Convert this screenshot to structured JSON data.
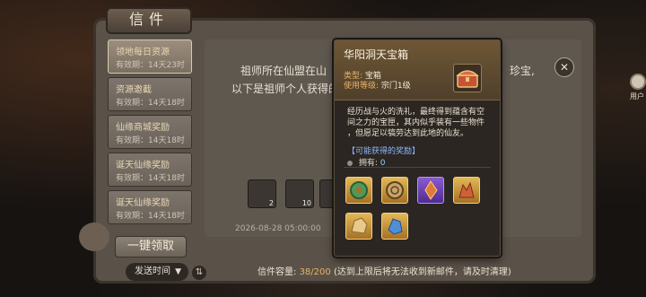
{
  "mail_panel": {
    "title": "信件",
    "mails": [
      {
        "title": "领地每日资源",
        "sub": "有效期：14天23时",
        "selected": true
      },
      {
        "title": "资源邀截",
        "sub": "有效期：14天18时",
        "selected": false
      },
      {
        "title": "仙缘商城奖励",
        "sub": "有效期：14天18时",
        "selected": false
      },
      {
        "title": "诞天仙缘奖励",
        "sub": "有效期：14天18时",
        "selected": false
      },
      {
        "title": "诞天仙缘奖励",
        "sub": "有效期：14天18时",
        "selected": false
      }
    ],
    "collect_all": "一键领取",
    "sort_label": "发送时间",
    "letter_line1": "祖师所在仙盟在山",
    "letter_line1_tail": "珍宝,",
    "letter_line2": "以下是祖师个人获得的ˋ",
    "attachments": [
      {
        "count": "2"
      },
      {
        "count": "10"
      },
      {
        "count": ""
      }
    ],
    "date": "2026-08-28 05:00:00",
    "capacity_label": "信件容量:",
    "capacity_value": "38/200",
    "capacity_note": "(达到上限后将无法收到新邮件，请及时清理)"
  },
  "side": {
    "user_label": "用户"
  },
  "tooltip": {
    "title": "华阳洞天宝箱",
    "type_label": "类型:",
    "type_value": "宝箱",
    "level_label": "使用等级:",
    "level_value": "宗门1级",
    "description_lines": [
      "经历战与火的洗礼，最终得到蕴含有空",
      "间之力的宝匣，其内似乎装有一些物件",
      "，但愿足以犒劳达到此地的仙友。"
    ],
    "possible_rewards": "【可能获得的奖励】",
    "owned_label": "拥有:",
    "owned_value": "0",
    "rewards": [
      {
        "icon": "jade-ring-icon",
        "rarity": "gold"
      },
      {
        "icon": "coin-disc-icon",
        "rarity": "gold"
      },
      {
        "icon": "fire-crystal-icon",
        "rarity": "purple"
      },
      {
        "icon": "flame-stone-icon",
        "rarity": "gold"
      },
      {
        "icon": "ore-chunk-icon",
        "rarity": "gold"
      },
      {
        "icon": "blue-crystal-icon",
        "rarity": "gold"
      }
    ]
  },
  "colors": {
    "accent_gold": "#e8b26b",
    "link_blue": "#8eb8ff",
    "panel_bg": "#2b2622"
  }
}
